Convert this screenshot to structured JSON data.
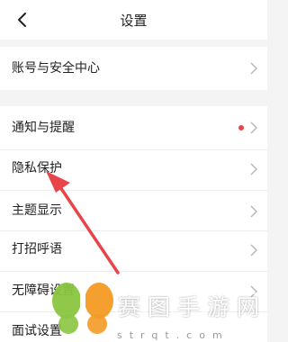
{
  "header": {
    "title": "设置",
    "back_icon": "chevron-left-icon"
  },
  "settings": {
    "account_security": "账号与安全中心",
    "notifications": "通知与提醒",
    "privacy": "隐私保护",
    "theme": "主题显示",
    "greeting": "打招呼语",
    "accessibility": "无障碍设置",
    "interview": "面试设置"
  },
  "colors": {
    "red_dot": "#e8454b",
    "annotation_arrow": "#e8454b",
    "page_bg": "#f4f4f4"
  },
  "watermark": {
    "logo": "butterfly-logo",
    "text": "赛图手游网",
    "url": "strqt.com"
  }
}
